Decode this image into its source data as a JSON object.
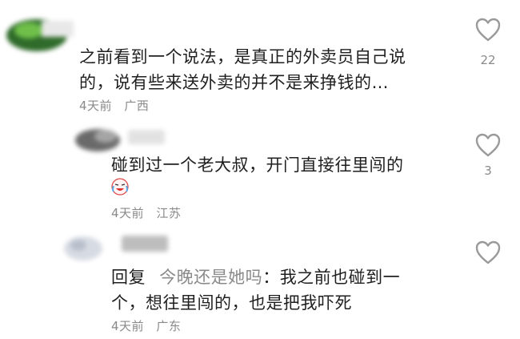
{
  "comments": [
    {
      "text": "之前看到一个说法，是真正的外卖员自己说的，说有些来送外卖的并不是来挣钱的…",
      "line1": "之前看到一个说法，是真正的外卖员自己说",
      "line2": "的，说有些来送外卖的并不是来挣钱的…",
      "time": "4天前",
      "location": "广西",
      "likes": "22"
    },
    {
      "text": "碰到过一个老大叔，开门直接往里闯的",
      "emoji": "crying-laughing-emoji",
      "time": "4天前",
      "location": "江苏",
      "likes": "3"
    },
    {
      "reply_label": "回复",
      "reply_to": "今晚还是她吗",
      "colon": "：",
      "line1": "我之前也碰到一",
      "line2": "个，想往里闯的，也是把我吓死",
      "time": "4天前",
      "location": "广东",
      "likes": ""
    }
  ],
  "icons": {
    "like": "heart-outline-icon"
  }
}
